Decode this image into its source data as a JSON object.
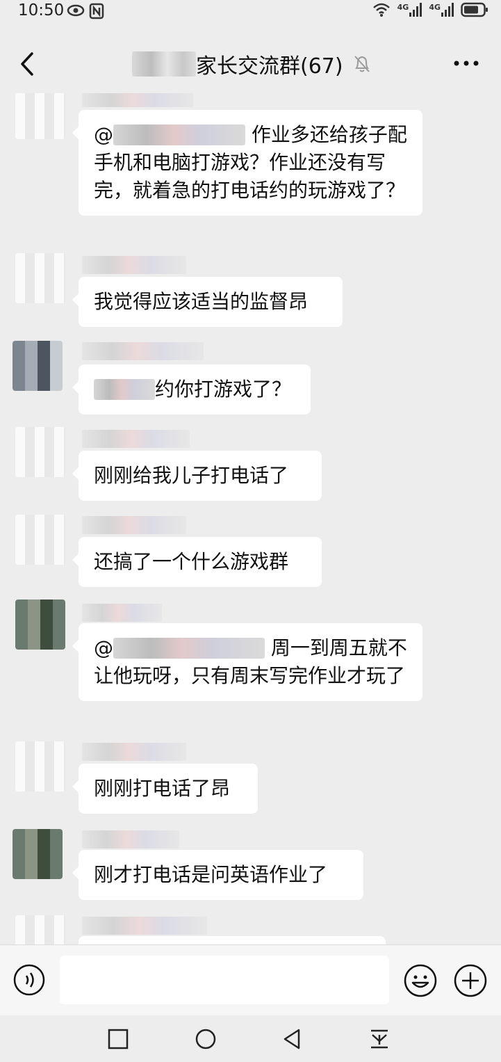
{
  "status_bar": {
    "time": "10:50",
    "network_1": "4G",
    "network_2": "4G"
  },
  "header": {
    "title_suffix": "家长交流群(67)"
  },
  "messages": [
    {
      "text_before": "@",
      "text_after": "作业多还给孩子配手机和电脑打游戏？作业还没有写完，就着急的打电话约的玩游戏了？"
    },
    {
      "text": "我觉得应该适当的监督昂"
    },
    {
      "text_after": "约你打游戏了？"
    },
    {
      "text": "刚刚给我儿子打电话了"
    },
    {
      "text": "还搞了一个什么游戏群"
    },
    {
      "text_before": "@",
      "text_after": "周一到周五就不让他玩呀，只有周末写完作业才玩了"
    },
    {
      "text": "刚刚打电话了昂"
    },
    {
      "text": "刚才打电话是问英语作业了"
    }
  ],
  "input": {
    "placeholder": ""
  },
  "icons": {
    "back": "back-arrow-icon",
    "mute": "bell-muted-icon",
    "more": "more-dots-icon",
    "voice": "voice-icon",
    "emoji": "emoji-icon",
    "plus": "plus-icon"
  }
}
